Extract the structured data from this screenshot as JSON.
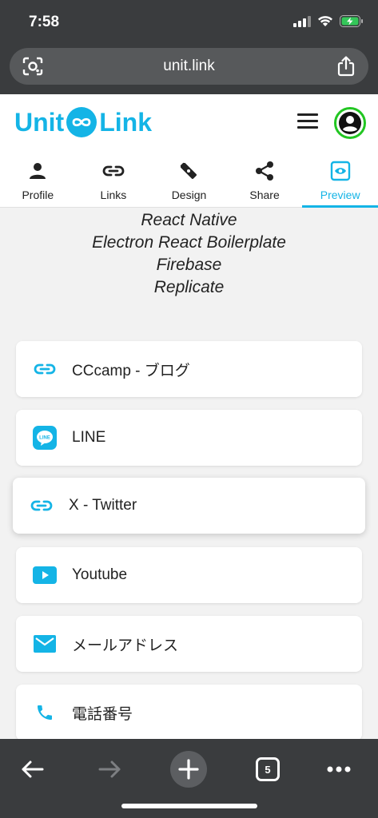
{
  "status": {
    "time": "7:58"
  },
  "browser": {
    "url": "unit.link",
    "tab_count": "5"
  },
  "app": {
    "logo_left": "Unit",
    "logo_right": "Link"
  },
  "tabs": [
    {
      "label": "Profile",
      "icon": "person-icon",
      "active": false
    },
    {
      "label": "Links",
      "icon": "link-icon",
      "active": false
    },
    {
      "label": "Design",
      "icon": "design-tools-icon",
      "active": false
    },
    {
      "label": "Share",
      "icon": "share-icon",
      "active": false
    },
    {
      "label": "Preview",
      "icon": "preview-eye-icon",
      "active": true
    }
  ],
  "tech_stack": [
    "React Native",
    "Electron React Boilerplate",
    "Firebase",
    "Replicate"
  ],
  "links": [
    {
      "label": "CCcamp - ブログ",
      "icon": "link-icon"
    },
    {
      "label": "LINE",
      "icon": "line-icon"
    },
    {
      "label": "X - Twitter",
      "icon": "link-icon"
    },
    {
      "label": "Youtube",
      "icon": "youtube-icon"
    },
    {
      "label": "メールアドレス",
      "icon": "mail-icon"
    },
    {
      "label": "電話番号",
      "icon": "phone-icon"
    }
  ],
  "colors": {
    "accent": "#14b4e6",
    "avatar_ring": "#22c622",
    "chrome": "#3a3c3e"
  }
}
